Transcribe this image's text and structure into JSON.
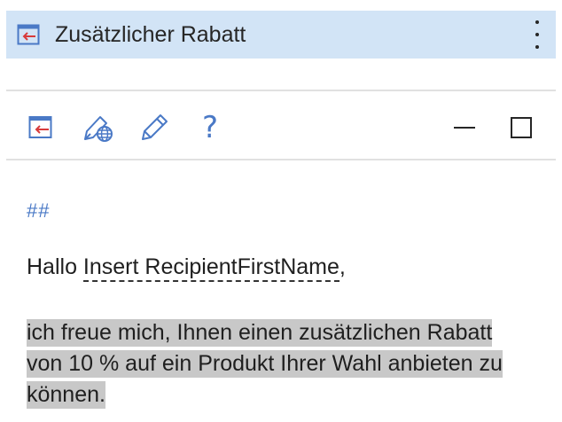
{
  "window": {
    "title": "Zusätzlicher Rabatt",
    "app_icon": "insert-template-icon",
    "more_icon": "more-vertical-icon"
  },
  "toolbar": {
    "buttons": [
      {
        "name": "insert-icon"
      },
      {
        "name": "sign-globe-icon"
      },
      {
        "name": "edit-pencil-icon"
      },
      {
        "name": "help-icon",
        "glyph": "?"
      },
      {
        "name": "minimize-icon"
      },
      {
        "name": "maximize-icon"
      }
    ]
  },
  "content": {
    "heading_marker": "##",
    "greeting_prefix": "Hallo ",
    "placeholder": "Insert RecipientFirstName",
    "greeting_suffix": ",",
    "body": "ich freue mich, Ihnen einen zusätzlichen Rabatt von 10 % auf ein Produkt Ihrer Wahl anbieten zu können."
  },
  "colors": {
    "titlebar_bg": "#d2e4f6",
    "accent": "#4a79c6",
    "icon_red": "#d83b3b",
    "highlight": "#c8c8c8"
  }
}
